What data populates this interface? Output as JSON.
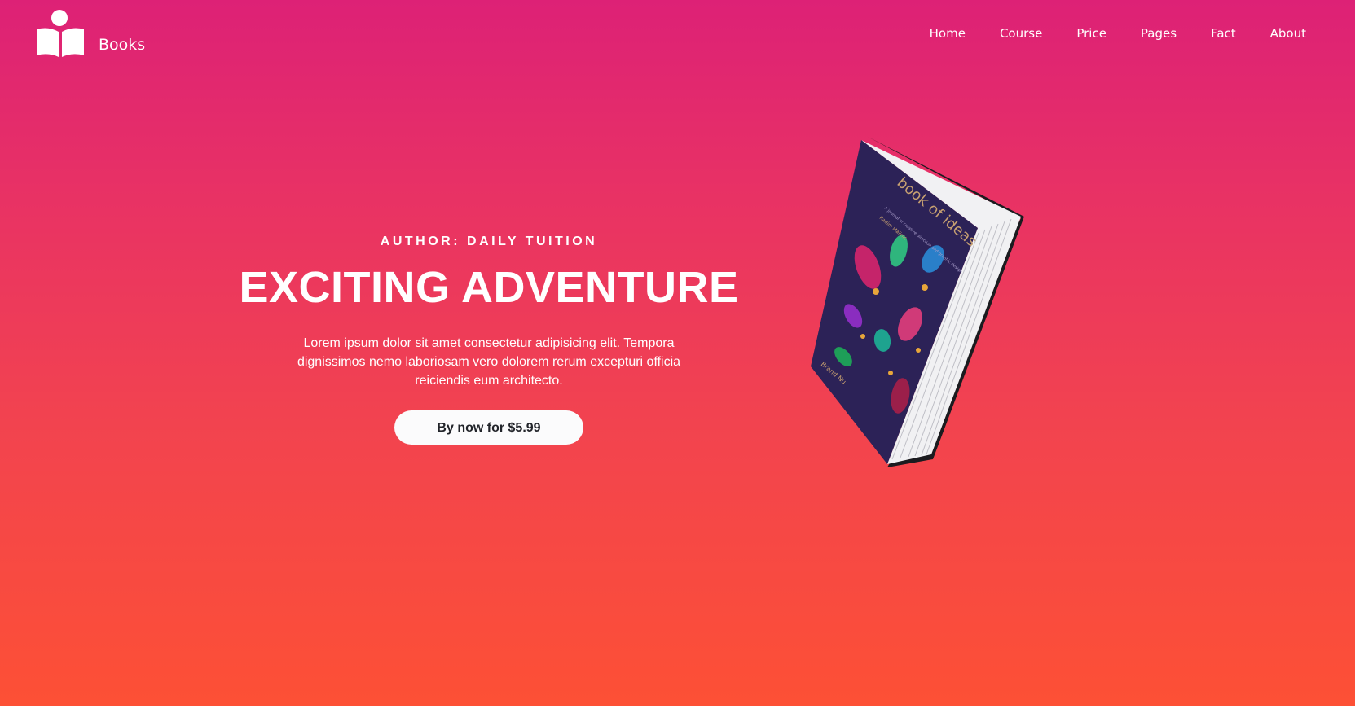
{
  "brand": {
    "name": "Books",
    "logo_icon": "open-book-reader-icon"
  },
  "nav": {
    "items": [
      {
        "label": "Home"
      },
      {
        "label": "Course"
      },
      {
        "label": "Price"
      },
      {
        "label": "Pages"
      },
      {
        "label": "Fact"
      },
      {
        "label": "About"
      }
    ]
  },
  "hero": {
    "author": "AUTHOR: DAILY TUITION",
    "title": "EXCITING ADVENTURE",
    "description": "Lorem ipsum dolor sit amet consectetur adipisicing elit. Tempora dignissimos nemo laboriosam vero dolorem rerum excepturi officia reiciendis eum architecto.",
    "button_label": "By now for $5.99"
  },
  "book": {
    "cover_title": "book of ideas",
    "cover_subtitle": "A journal of creative direction and graphic design",
    "cover_author_top": "Radim Malinic",
    "cover_brand": "Brand Nu"
  },
  "colors": {
    "gradient_top": "#dd2176",
    "gradient_bottom": "#fd5035",
    "button_bg": "#fbfbfc",
    "button_text": "#22242a",
    "book_cover": "#2c2257"
  }
}
